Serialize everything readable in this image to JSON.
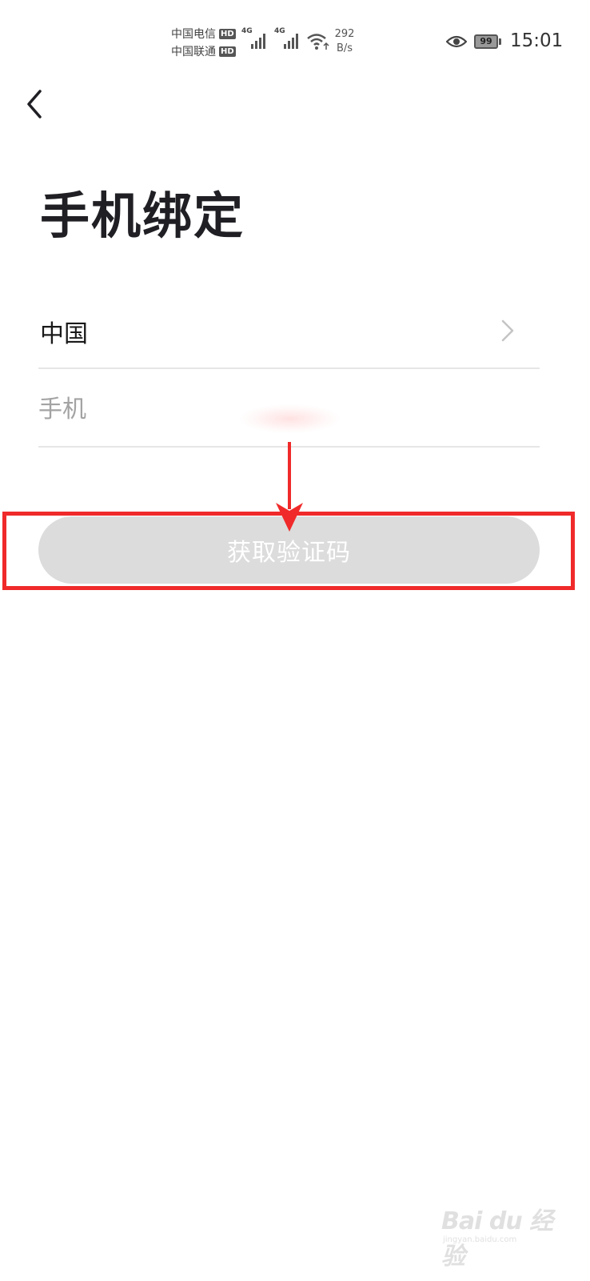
{
  "status_bar": {
    "carrier_1": "中国电信",
    "carrier_2": "中国联通",
    "hd_badge": "HD",
    "network_type": "4G",
    "speed_value": "292",
    "speed_unit": "B/s",
    "battery_level": "99",
    "time": "15:01",
    "icons": [
      "signal-icon",
      "wifi-icon",
      "eye-icon",
      "battery-icon"
    ]
  },
  "header": {
    "back_icon": "chevron-left-icon",
    "title": "手机绑定"
  },
  "form": {
    "country_label": "中国",
    "country_icon": "chevron-right-icon",
    "phone_placeholder": "手机",
    "phone_value": ""
  },
  "actions": {
    "get_code_label": "获取验证码"
  },
  "annotation": {
    "highlight_color": "#f02a2a",
    "arrow_color": "#f02a2a"
  },
  "watermark": {
    "brand": "Bai du 经验",
    "sub": "jingyan.baidu.com"
  },
  "colors": {
    "title": "#1f1f24",
    "button_bg": "#dcdcdc",
    "button_text": "#ffffff",
    "divider": "#e6e6e6",
    "placeholder": "#a3a3a3"
  }
}
